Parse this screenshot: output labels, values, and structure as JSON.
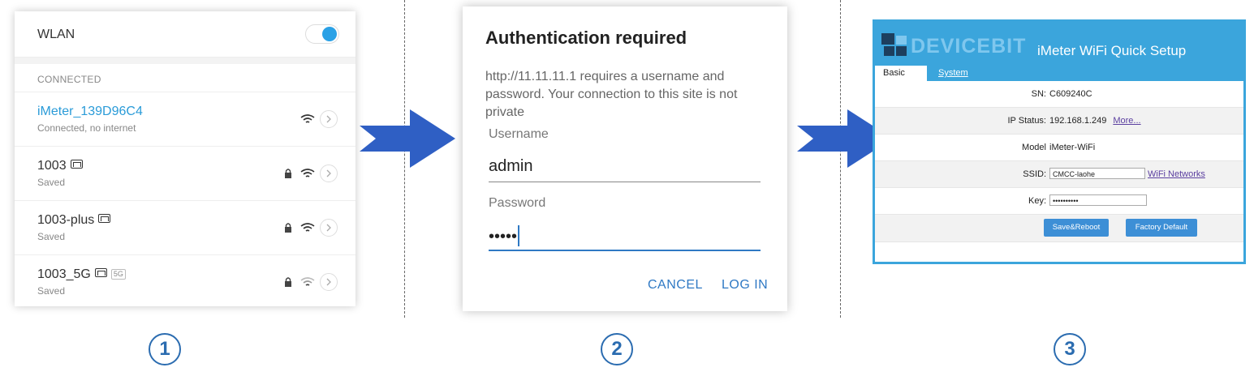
{
  "wlan": {
    "title": "WLAN",
    "section": "CONNECTED",
    "networks": [
      {
        "name": "iMeter_139D96C4",
        "status": "Connected, no internet"
      },
      {
        "name": "1003",
        "status": "Saved"
      },
      {
        "name": "1003-plus",
        "status": "Saved"
      },
      {
        "name": "1003_5G",
        "badge": "5G",
        "status": "Saved"
      }
    ]
  },
  "auth": {
    "title": "Authentication required",
    "message": "http://11.11.11.1 requires a username and password. Your connection to this site is not private",
    "username_label": "Username",
    "username_value": "admin",
    "password_label": "Password",
    "password_value": "•••••",
    "cancel_label": "CANCEL",
    "login_label": "LOG IN"
  },
  "imeter": {
    "brand": "DEVICEBIT",
    "title": "iMeter WiFi Quick Setup",
    "tabs": [
      "Basic",
      "System"
    ],
    "sn_label": "SN:",
    "sn_value": "C609240C",
    "ip_label": "IP Status:",
    "ip_value": "192.168.1.249",
    "ip_more": "More...",
    "model_label": "Model",
    "model_value": "iMeter-WiFi",
    "ssid_label": "SSID:",
    "ssid_value": "CMCC-laohe",
    "ssid_link": "WiFi Networks",
    "key_label": "Key:",
    "key_value": "••••••••••",
    "save_label": "Save&Reboot",
    "factory_label": "Factory Default"
  },
  "steps": [
    "1",
    "2",
    "3"
  ],
  "colors": {
    "accent": "#2b6cb0",
    "wifi_blue": "#2a9bd8",
    "imeter_blue": "#3ba5dc",
    "arrow": "#2f5fc4"
  }
}
